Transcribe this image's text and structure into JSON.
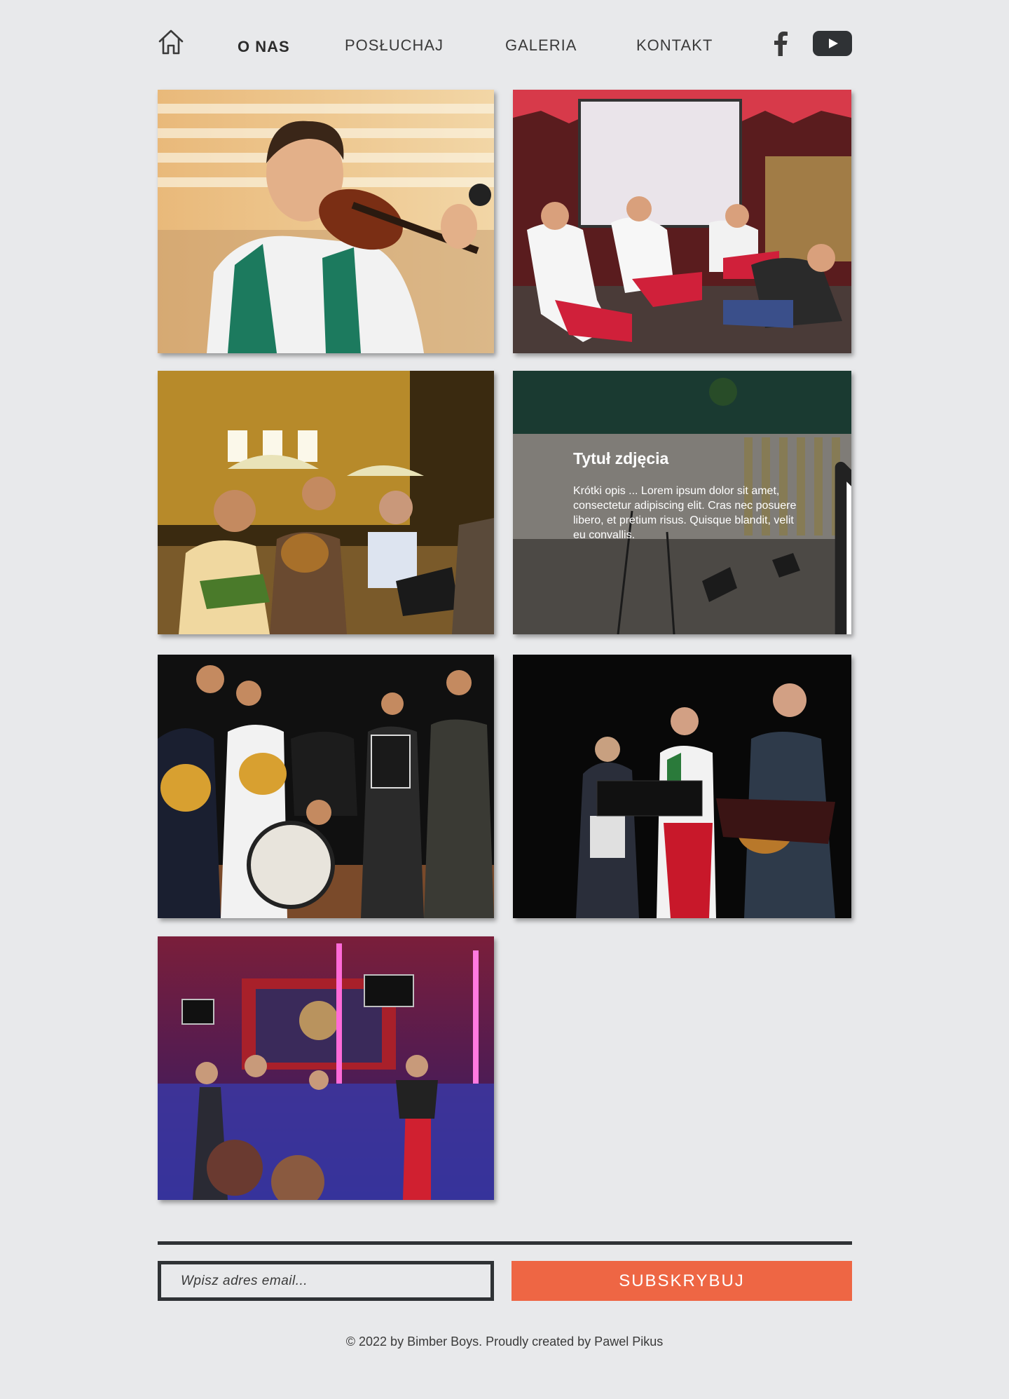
{
  "nav": {
    "home_icon": "home-icon",
    "items": [
      {
        "label": "O NAS",
        "active": true
      },
      {
        "label": "POSŁUCHAJ",
        "active": false
      },
      {
        "label": "GALERIA",
        "active": false
      },
      {
        "label": "KONTAKT",
        "active": false
      }
    ],
    "social": [
      "facebook-icon",
      "youtube-icon"
    ]
  },
  "gallery": {
    "hovered_photo": {
      "title": "Tytuł zdjęcia",
      "description": "Krótki opis ... Lorem ipsum dolor sit amet, consectetur adipiscing elit. Cras nec posuere libero, et pretium risus. Quisque blandit, velit eu convallis."
    }
  },
  "subscribe": {
    "placeholder": "Wpisz adres email...",
    "button_label": "SUBSKRYBUJ"
  },
  "footer": {
    "copyright": "© 2022 by Bimber Boys. Proudly created by Pawel Pikus"
  },
  "colors": {
    "background": "#e8e9eb",
    "accent": "#ee6644",
    "dark": "#2f3235"
  }
}
